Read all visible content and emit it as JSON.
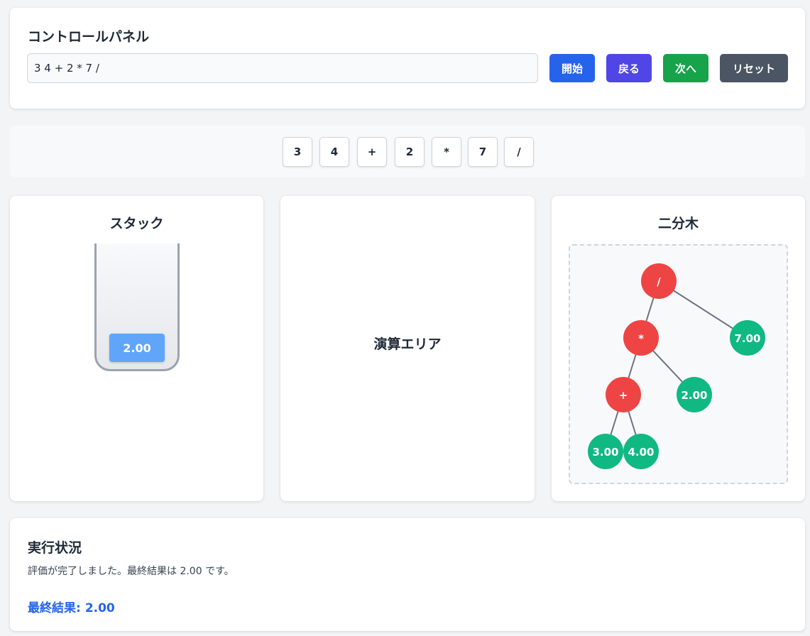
{
  "control_panel": {
    "title": "コントロールパネル",
    "input_value": "3 4 + 2 * 7 /",
    "buttons": {
      "start": "開始",
      "back": "戻る",
      "next": "次へ",
      "reset": "リセット"
    }
  },
  "tokens": [
    "3",
    "4",
    "+",
    "2",
    "*",
    "7",
    "/"
  ],
  "stack": {
    "title": "スタック",
    "items": [
      "2.00"
    ]
  },
  "calc_area": {
    "label": "演算エリア"
  },
  "tree": {
    "title": "二分木",
    "nodes": [
      {
        "id": "div",
        "label": "/",
        "kind": "operator"
      },
      {
        "id": "mul",
        "label": "*",
        "kind": "operator"
      },
      {
        "id": "n7",
        "label": "7.00",
        "kind": "number"
      },
      {
        "id": "add",
        "label": "+",
        "kind": "operator"
      },
      {
        "id": "n2",
        "label": "2.00",
        "kind": "number"
      },
      {
        "id": "n3",
        "label": "3.00",
        "kind": "number"
      },
      {
        "id": "n4",
        "label": "4.00",
        "kind": "number"
      }
    ],
    "edges": [
      [
        "div",
        "mul"
      ],
      [
        "div",
        "n7"
      ],
      [
        "mul",
        "add"
      ],
      [
        "mul",
        "n2"
      ],
      [
        "add",
        "n3"
      ],
      [
        "add",
        "n4"
      ]
    ],
    "colors": {
      "operator": "#ef4444",
      "number": "#10b981",
      "edge": "#6b7280"
    }
  },
  "status": {
    "title": "実行状況",
    "message": "評価が完了しました。最終結果は 2.00 です。",
    "final_label": "最終結果:",
    "final_value": "2.00"
  }
}
